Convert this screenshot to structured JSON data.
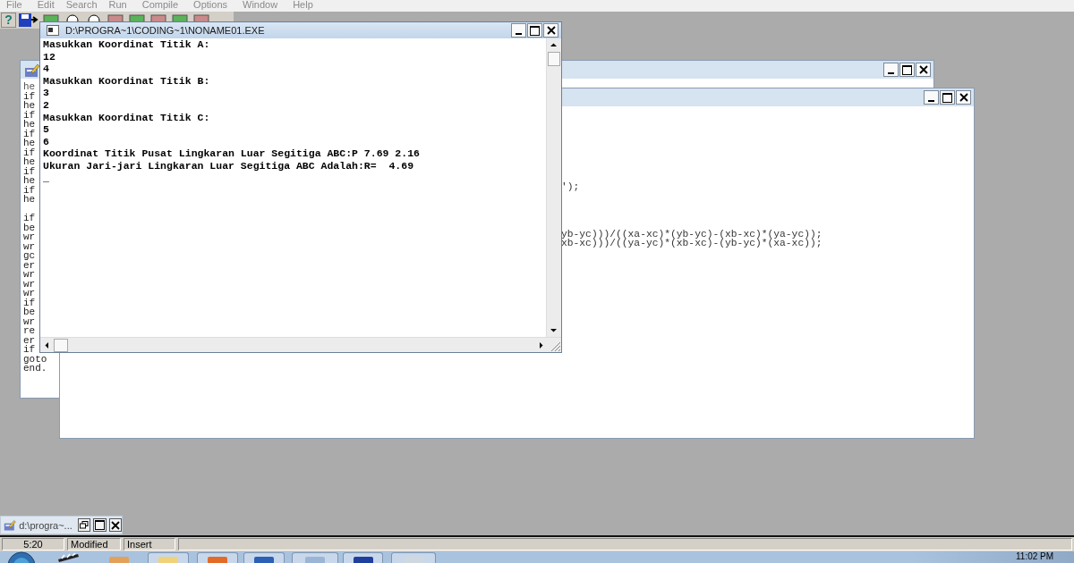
{
  "menu_bar": [
    "File",
    "Edit",
    "Search",
    "Run",
    "Compile",
    "Options",
    "Window",
    "Help"
  ],
  "toolbar": {
    "help": "?"
  },
  "editor_back": {
    "code_blocks": [
      [
        "he",
        "if",
        "he",
        "if",
        "he",
        "if",
        "he",
        "if",
        "he",
        "if",
        "he",
        "if",
        "he"
      ],
      [
        "if",
        "be",
        "wr",
        "wr",
        "gc",
        "er",
        "wr",
        "wr",
        "wr",
        "if",
        "be",
        "wr",
        "re",
        "er",
        "if",
        "goto",
        "end."
      ]
    ]
  },
  "editor_front": {
    "code_blocks": [
      [
        "');"
      ],
      [
        "yb-yc)))/((xa-xc)*(yb-yc)-(xb-xc)*(ya-yc));",
        "xb-xc)))/((ya-yc)*(xb-xc)-(yb-yc)*(xa-xc));"
      ]
    ]
  },
  "console": {
    "title": "D:\\PROGRA~1\\CODING~1\\NONAME01.EXE",
    "lines": [
      "Masukkan Koordinat Titik A:",
      "12",
      "4",
      "Masukkan Koordinat Titik B:",
      "3",
      "2",
      "Masukkan Koordinat Titik C:",
      "5",
      "6",
      "Koordinat Titik Pusat Lingkaran Luar Segitiga ABC:P 7.69 2.16",
      "Ukuran Jari-jari Lingkaran Luar Segitiga ABC Adalah:R=  4.69"
    ],
    "cursor": "_"
  },
  "minimized_window": {
    "title": "d:\\progra~..."
  },
  "status_bar": {
    "position": "5:20",
    "modified": "Modified",
    "mode": "Insert"
  },
  "taskbar": {
    "clock": "11:02 PM"
  }
}
